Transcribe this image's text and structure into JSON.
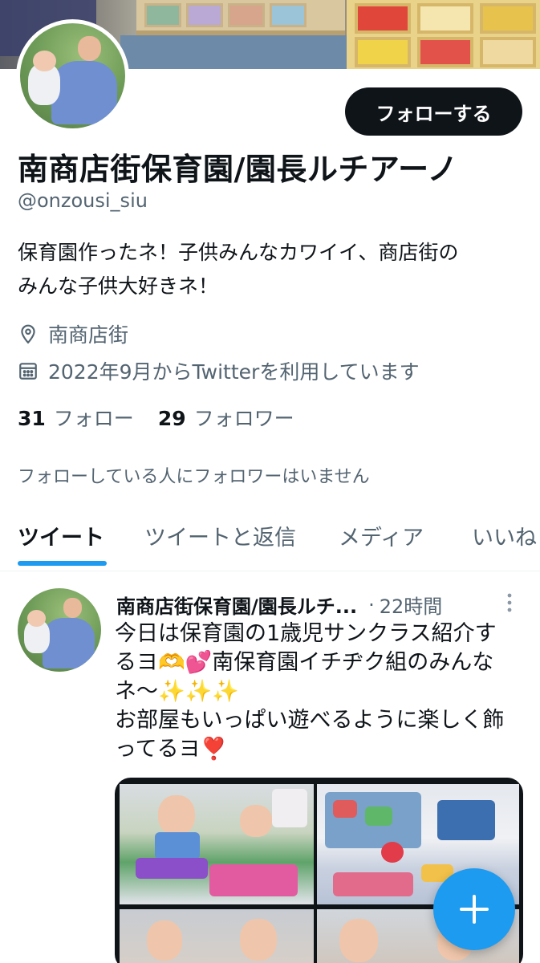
{
  "profile": {
    "display_name": "南商店街保育園/園長ルチアーノ",
    "handle": "@onzousi_siu",
    "bio_line1": "保育園作ったネ！子供みんなカワイイ、商店街の",
    "bio_line2": "みんな子供大好きネ！",
    "location": "南商店街",
    "joined": "2022年9月からTwitterを利用しています",
    "following_count": "31",
    "following_label": "フォロー",
    "followers_count": "29",
    "followers_label": "フォロワー",
    "no_followers_note": "フォローしている人にフォロワーはいません",
    "follow_button_label": "フォローする"
  },
  "icons": {
    "location": "location-pin-icon",
    "calendar": "calendar-icon",
    "more": "more-vertical-icon",
    "compose": "plus-icon"
  },
  "tabs": [
    {
      "label": "ツイート",
      "active": true
    },
    {
      "label": "ツイートと返信",
      "active": false
    },
    {
      "label": "メディア",
      "active": false
    },
    {
      "label": "いいね",
      "active": false
    }
  ],
  "tweet": {
    "author_name": "南商店街保育園/園長ルチ...",
    "separator": "·",
    "time": "22時間",
    "text_line1": "今日は保育園の1歳児サンクラス紹介す",
    "text_line2": "るヨ🫶💕南保育園イチヂク組のみんな",
    "text_line3": "ネ〜✨✨✨",
    "text_line4": "お部屋もいっぱい遊べるように楽しく飾",
    "text_line5": "ってるヨ❣️"
  },
  "colors": {
    "accent": "#1d9bf0",
    "text_primary": "#0f1419",
    "text_secondary": "#536471",
    "button_dark": "#0f1419"
  }
}
